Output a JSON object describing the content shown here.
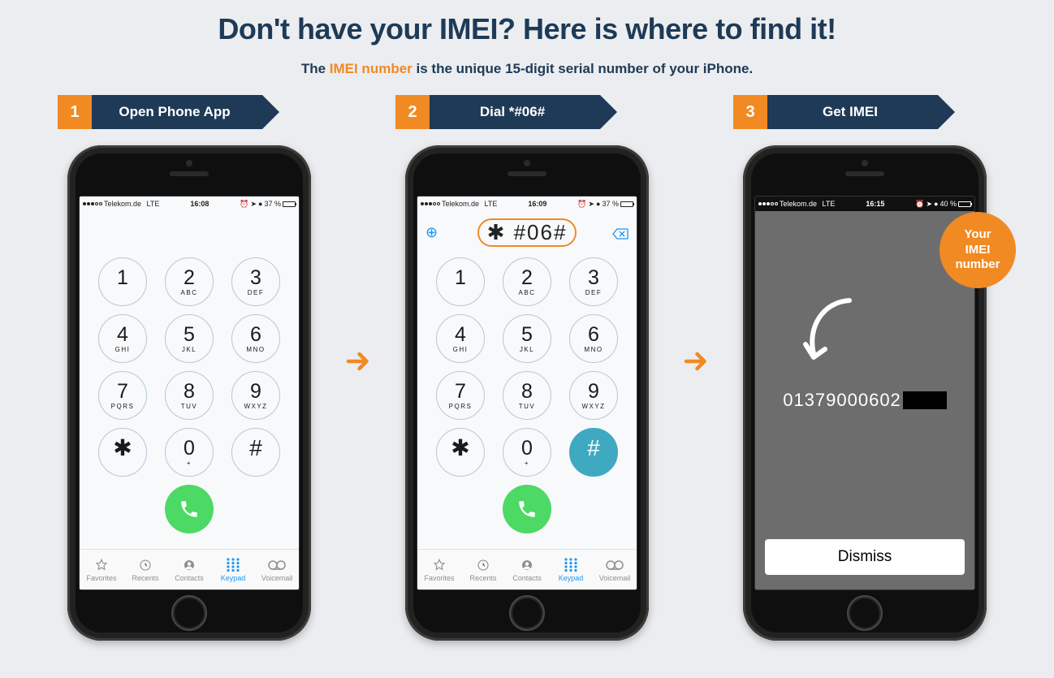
{
  "heading": "Don't have your IMEI? Here is where to find it!",
  "sub_pre": "The ",
  "sub_highlight": "IMEI number",
  "sub_post": " is the unique 15-digit serial number of your iPhone.",
  "steps": [
    {
      "num": "1",
      "title": "Open Phone App",
      "carrier": "Telekom.de",
      "net": "LTE",
      "time": "16:08",
      "batt": "37 %"
    },
    {
      "num": "2",
      "title": "Dial *#06#",
      "carrier": "Telekom.de",
      "net": "LTE",
      "time": "16:09",
      "batt": "37 %",
      "dialed": "✱ #06#"
    },
    {
      "num": "3",
      "title": "Get IMEI",
      "carrier": "Telekom.de",
      "net": "LTE",
      "time": "16:15",
      "batt": "40 %"
    }
  ],
  "keypad": [
    {
      "d": "1",
      "l": ""
    },
    {
      "d": "2",
      "l": "ABC"
    },
    {
      "d": "3",
      "l": "DEF"
    },
    {
      "d": "4",
      "l": "GHI"
    },
    {
      "d": "5",
      "l": "JKL"
    },
    {
      "d": "6",
      "l": "MNO"
    },
    {
      "d": "7",
      "l": "PQRS"
    },
    {
      "d": "8",
      "l": "TUV"
    },
    {
      "d": "9",
      "l": "WXYZ"
    },
    {
      "d": "✱",
      "l": "",
      "sym": true
    },
    {
      "d": "0",
      "l": "+"
    },
    {
      "d": "#",
      "l": "",
      "sym": true
    }
  ],
  "tabs": [
    {
      "label": "Favorites"
    },
    {
      "label": "Recents"
    },
    {
      "label": "Contacts"
    },
    {
      "label": "Keypad",
      "active": true
    },
    {
      "label": "Voicemail"
    }
  ],
  "imei_partial": "01379000602",
  "dismiss_label": "Dismiss",
  "badge_line1": "Your",
  "badge_line2": "IMEI",
  "badge_line3": "number"
}
